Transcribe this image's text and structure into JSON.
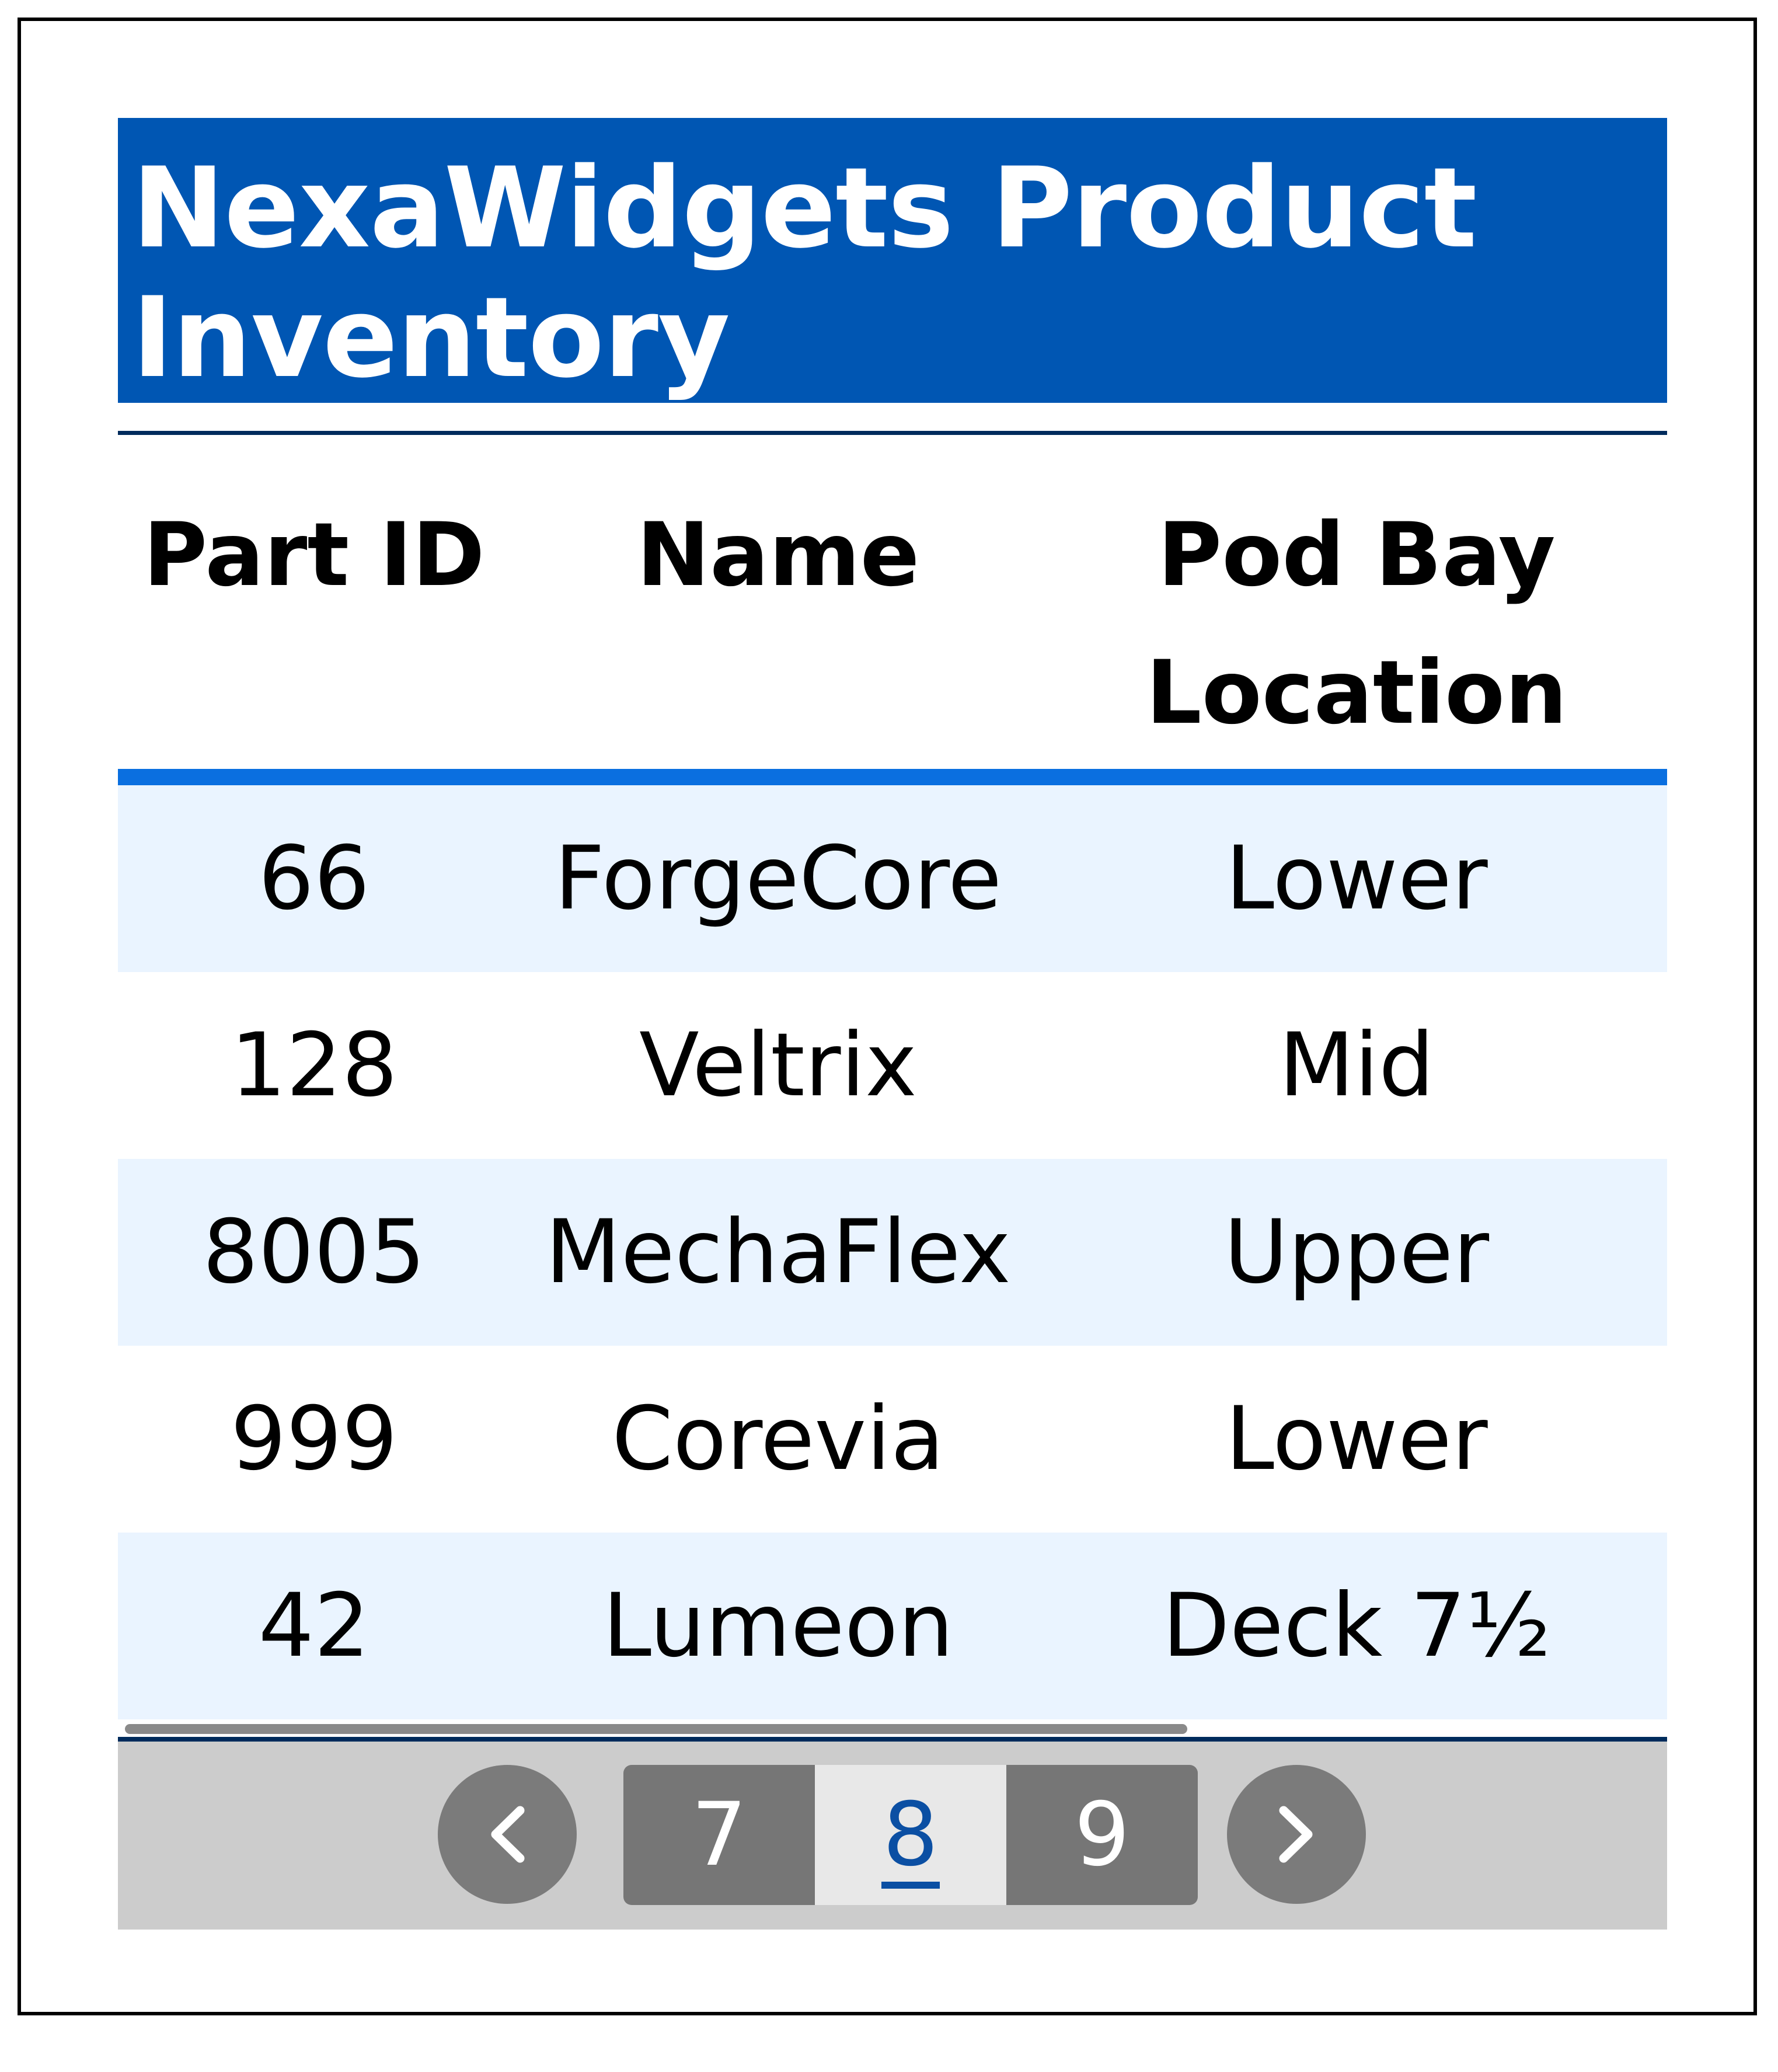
{
  "header": {
    "title": "NexaWidgets Product Inventory"
  },
  "table": {
    "columns": [
      "Part ID",
      "Name",
      "Pod Bay Location"
    ],
    "rows": [
      {
        "part_id": "66",
        "name": "ForgeCore",
        "location": "Lower"
      },
      {
        "part_id": "128",
        "name": "Veltrix",
        "location": "Mid"
      },
      {
        "part_id": "8005",
        "name": "MechaFlex",
        "location": "Upper"
      },
      {
        "part_id": "999",
        "name": "Corevia",
        "location": "Lower"
      },
      {
        "part_id": "42",
        "name": "Lumeon",
        "location": "Deck 7½"
      }
    ]
  },
  "pagination": {
    "prev_icon": "chevron-left-icon",
    "next_icon": "chevron-right-icon",
    "pages": [
      "7",
      "8",
      "9"
    ],
    "current_page": "8"
  },
  "colors": {
    "title_bg": "#0056b3",
    "header_rule": "#0a6fe0",
    "dark_rule": "#002b5c",
    "alt_row": "#eaf4ff",
    "pager_bg": "#cccccc",
    "page_btn": "#767676",
    "current_page_text": "#0b4fa3"
  }
}
